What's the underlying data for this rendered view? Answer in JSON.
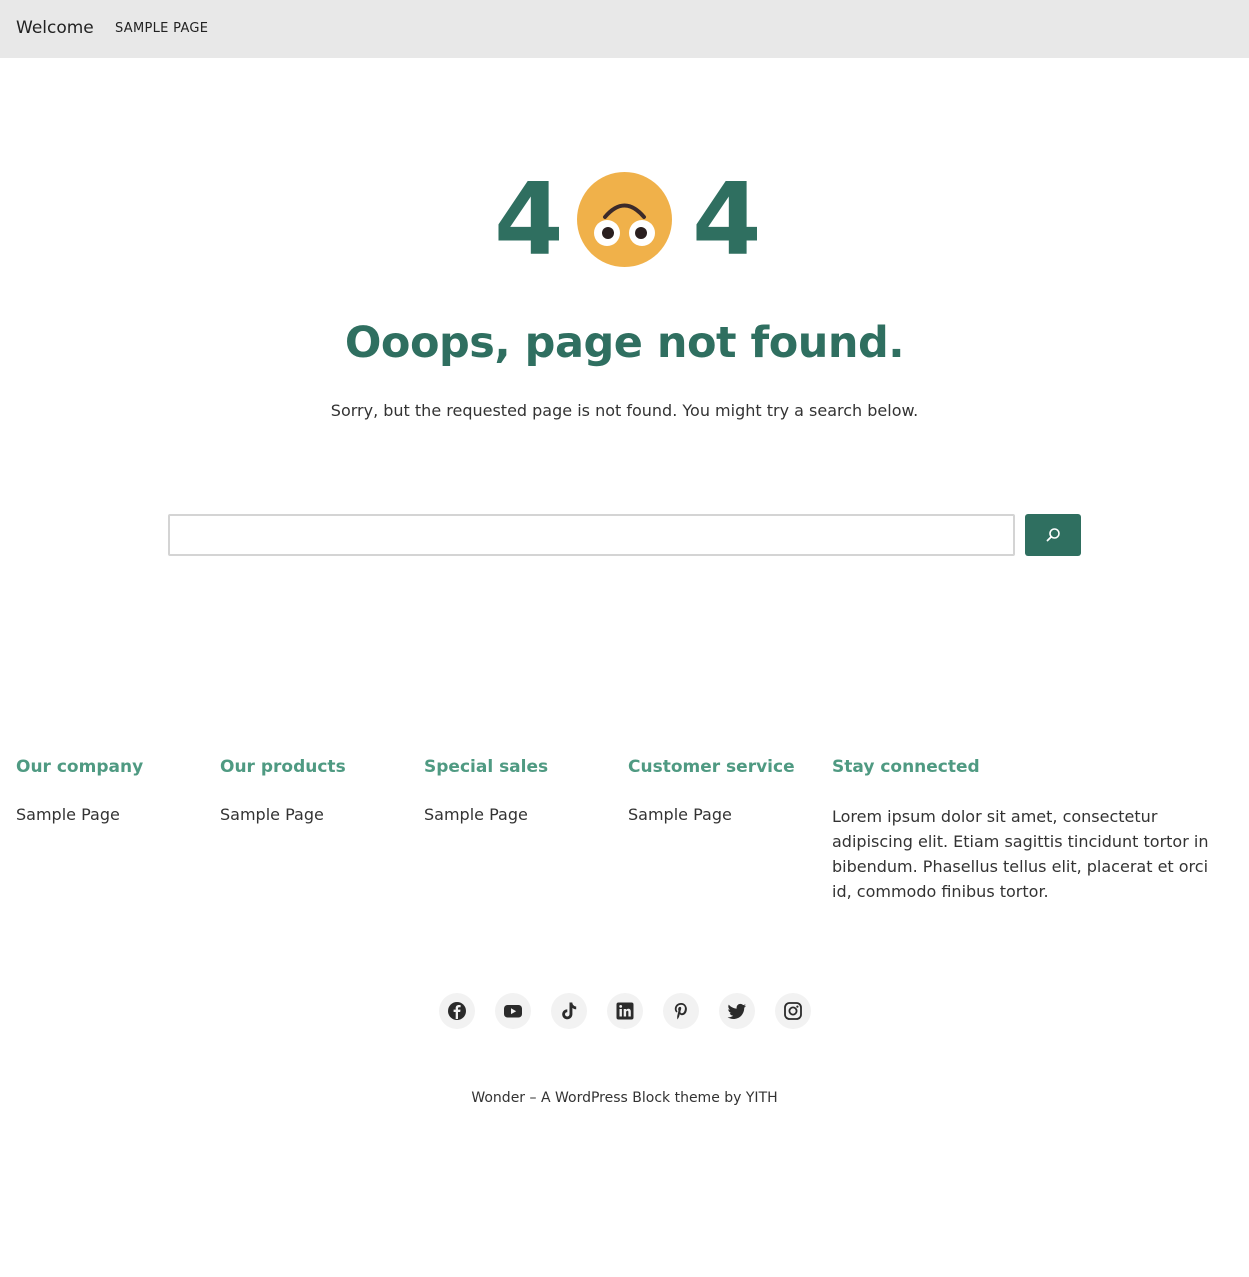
{
  "header": {
    "site_title": "Welcome",
    "nav": [
      "SAMPLE PAGE"
    ]
  },
  "error": {
    "digit_left": "4",
    "digit_right": "4",
    "face_icon": "upside-down-face-icon",
    "heading": "Ooops, page not found.",
    "message": "Sorry, but the requested page is not found. You might try a search below."
  },
  "search": {
    "value": "",
    "button_icon": "search-icon"
  },
  "footer": {
    "columns": [
      {
        "heading": "Our company",
        "links": [
          "Sample Page"
        ]
      },
      {
        "heading": "Our products",
        "links": [
          "Sample Page"
        ]
      },
      {
        "heading": "Special sales",
        "links": [
          "Sample Page"
        ]
      },
      {
        "heading": "Customer service",
        "links": [
          "Sample Page"
        ]
      },
      {
        "heading": "Stay connected",
        "text": "Lorem ipsum dolor sit amet, consectetur adipiscing elit. Etiam sagittis tincidunt tortor in bibendum. Phasellus tellus elit, placerat et orci id, commodo finibus tortor."
      }
    ],
    "socials": [
      "facebook-icon",
      "youtube-icon",
      "tiktok-icon",
      "linkedin-icon",
      "pinterest-icon",
      "twitter-icon",
      "instagram-icon"
    ],
    "credit": "Wonder – A WordPress Block theme by YITH"
  },
  "colors": {
    "brand_green": "#2f6f60",
    "heading_green": "#4f9a82",
    "face_yellow": "#f0b14a",
    "topbar_bg": "#e8e8e8"
  }
}
